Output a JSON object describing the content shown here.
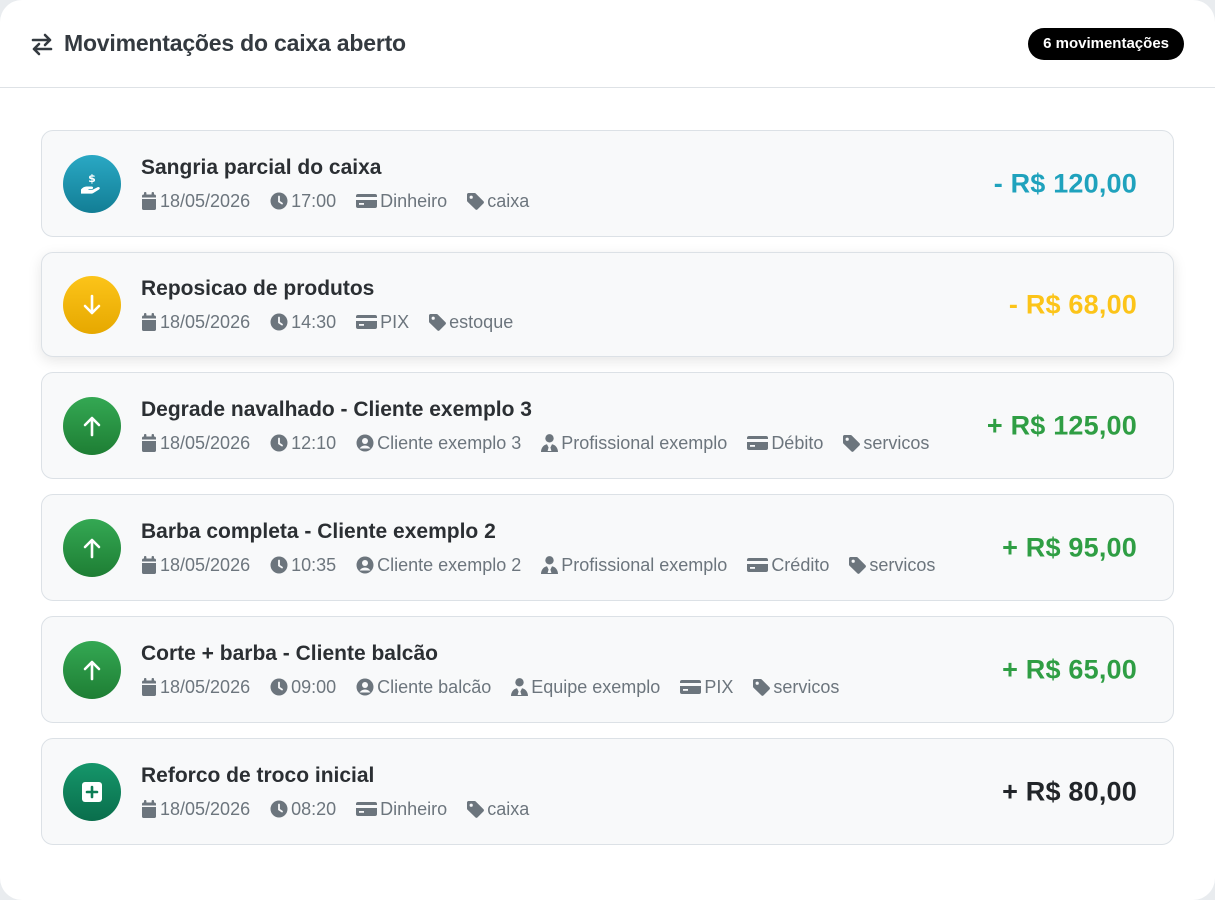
{
  "header": {
    "title": "Movimentações do caixa aberto",
    "count_badge": "6 movimentações"
  },
  "colors": {
    "teal": "#1fa2bd",
    "yellow": "#fcc419",
    "green": "#2f9e44",
    "dark": "#212529"
  },
  "movements": [
    {
      "title": "Sangria parcial do caixa",
      "icon": "hand-money-icon",
      "date": "18/05/2026",
      "time": "17:00",
      "client": "",
      "professional": "",
      "payment": "Dinheiro",
      "category": "caixa",
      "amount": "- R$ 120,00"
    },
    {
      "title": "Reposicao de produtos",
      "icon": "arrow-down-icon",
      "date": "18/05/2026",
      "time": "14:30",
      "client": "",
      "professional": "",
      "payment": "PIX",
      "category": "estoque",
      "amount": "- R$ 68,00"
    },
    {
      "title": "Degrade navalhado - Cliente exemplo 3",
      "icon": "arrow-up-icon",
      "date": "18/05/2026",
      "time": "12:10",
      "client": "Cliente exemplo 3",
      "professional": "Profissional exemplo",
      "payment": "Débito",
      "category": "servicos",
      "amount": "+ R$ 125,00"
    },
    {
      "title": "Barba completa - Cliente exemplo 2",
      "icon": "arrow-up-icon",
      "date": "18/05/2026",
      "time": "10:35",
      "client": "Cliente exemplo 2",
      "professional": "Profissional exemplo",
      "payment": "Crédito",
      "category": "servicos",
      "amount": "+ R$ 95,00"
    },
    {
      "title": "Corte + barba - Cliente balcão",
      "icon": "arrow-up-icon",
      "date": "18/05/2026",
      "time": "09:00",
      "client": "Cliente balcão",
      "professional": "Equipe exemplo",
      "payment": "PIX",
      "category": "servicos",
      "amount": "+ R$ 65,00"
    },
    {
      "title": "Reforco de troco inicial",
      "icon": "plus-square-icon",
      "date": "18/05/2026",
      "time": "08:20",
      "client": "",
      "professional": "",
      "payment": "Dinheiro",
      "category": "caixa",
      "amount": "+ R$ 80,00"
    }
  ]
}
